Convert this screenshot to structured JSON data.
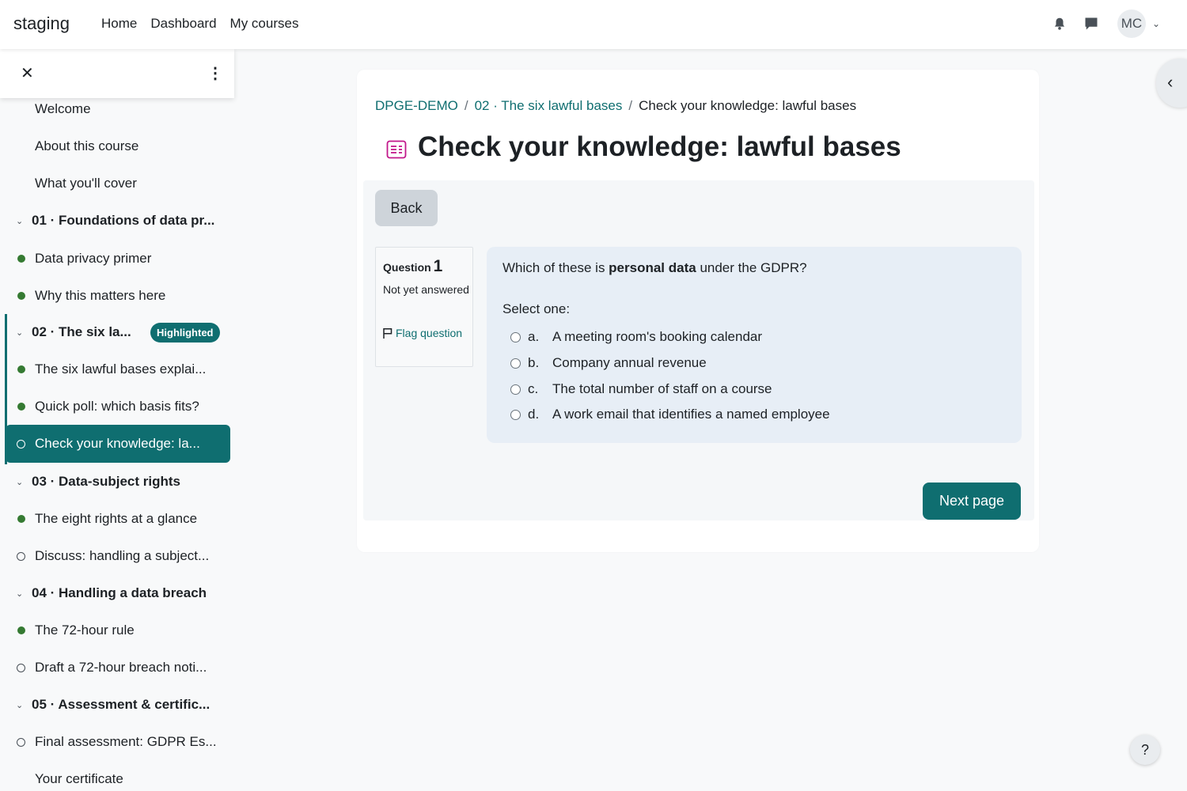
{
  "nav": {
    "brand": "staging",
    "links": [
      "Home",
      "Dashboard",
      "My courses"
    ],
    "user_initials": "MC"
  },
  "drawer": {
    "items": [
      {
        "label": "Welcome",
        "kind": "plain"
      },
      {
        "label": "About this course",
        "kind": "plain"
      },
      {
        "label": "What you'll cover",
        "kind": "plain"
      },
      {
        "label": "01 · Foundations of data pr...",
        "kind": "section"
      },
      {
        "label": "Data privacy primer",
        "kind": "done"
      },
      {
        "label": "Why this matters here",
        "kind": "done"
      },
      {
        "label": "02 · The six la...",
        "kind": "section",
        "badge": "Highlighted"
      },
      {
        "label": "The six lawful bases explai...",
        "kind": "done"
      },
      {
        "label": "Quick poll: which basis fits?",
        "kind": "done"
      },
      {
        "label": "Check your knowledge: la...",
        "kind": "current"
      },
      {
        "label": "03 · Data-subject rights",
        "kind": "section"
      },
      {
        "label": "The eight rights at a glance",
        "kind": "done"
      },
      {
        "label": "Discuss: handling a subject...",
        "kind": "todo"
      },
      {
        "label": "04 · Handling a data breach",
        "kind": "section"
      },
      {
        "label": "The 72-hour rule",
        "kind": "done"
      },
      {
        "label": "Draft a 72-hour breach noti...",
        "kind": "todo"
      },
      {
        "label": "05 · Assessment & certific...",
        "kind": "section"
      },
      {
        "label": "Final assessment: GDPR Es...",
        "kind": "todo"
      },
      {
        "label": "Your certificate",
        "kind": "plain"
      }
    ]
  },
  "breadcrumb": {
    "course": "DPGE-DEMO",
    "section": "02 · The six lawful bases",
    "separator": "/",
    "current": "Check your knowledge: lawful bases"
  },
  "page": {
    "title": "Check your knowledge: lawful bases",
    "back_label": "Back",
    "next_label": "Next page"
  },
  "question": {
    "label": "Question",
    "number": "1",
    "state": "Not yet answered",
    "flag_label": "Flag question",
    "text_before": "Which of these is ",
    "text_bold": "personal data",
    "text_after": " under the GDPR?",
    "prompt": "Select one:",
    "answers": [
      {
        "letter": "a.",
        "text": "A meeting room's booking calendar"
      },
      {
        "letter": "b.",
        "text": "Company annual revenue"
      },
      {
        "letter": "c.",
        "text": "The total number of staff on a course"
      },
      {
        "letter": "d.",
        "text": "A work email that identifies a named employee"
      }
    ]
  },
  "help_label": "?",
  "colors": {
    "accent": "#0f6e70",
    "complete_dot": "#357a32",
    "question_bg": "#e7eef6",
    "activity_icon": "#c2188b"
  }
}
